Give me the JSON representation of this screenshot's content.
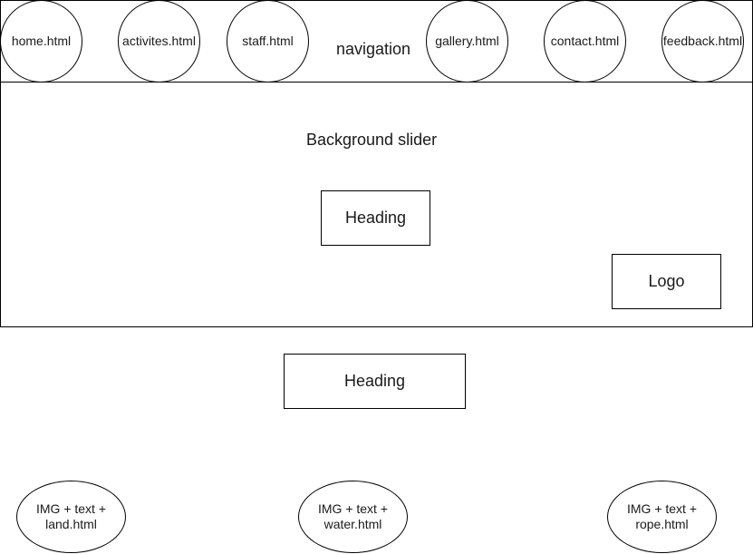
{
  "navigation": {
    "label": "navigation",
    "items": [
      {
        "label": "home.html"
      },
      {
        "label": "activites.html"
      },
      {
        "label": "staff.html"
      },
      {
        "label": "gallery.html"
      },
      {
        "label": "contact.html"
      },
      {
        "label": "feedback.html"
      }
    ]
  },
  "slider": {
    "label": "Background slider",
    "heading": "Heading",
    "logo": "Logo"
  },
  "main": {
    "heading": "Heading",
    "cards": [
      {
        "line1": "IMG + text +",
        "line2": "land.html"
      },
      {
        "line1": "IMG + text +",
        "line2": "water.html"
      },
      {
        "line1": "IMG + text +",
        "line2": "rope.html"
      }
    ]
  }
}
